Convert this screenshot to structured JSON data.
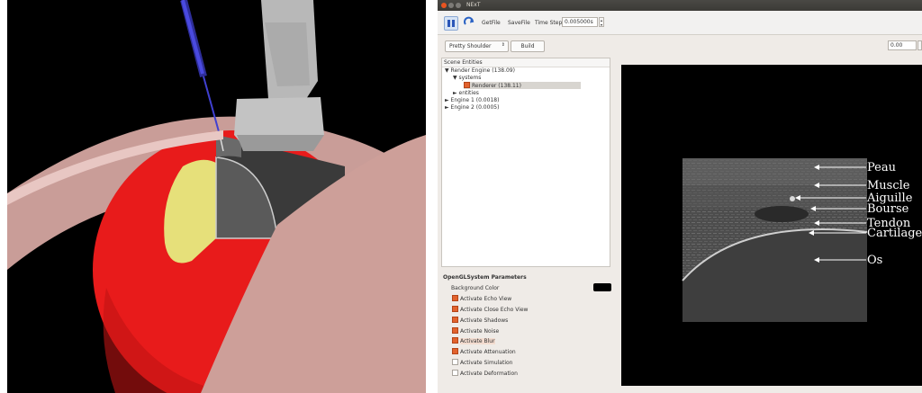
{
  "window": {
    "title": "NExT"
  },
  "toolbar": {
    "getfile_label": "GetFile",
    "savefile_label": "SaveFile",
    "timestep_label": "Time Step :",
    "timestep_value": "0.005000s"
  },
  "scene_selector": {
    "selected": "Pretty Shoulder",
    "build_label": "Build",
    "value": "0.00"
  },
  "scene_tree": {
    "header": "Scene Entities",
    "rows": [
      {
        "label": "Render Engine  (138.09)",
        "arrow": "▼"
      },
      {
        "label": "systems",
        "arrow": "▼"
      },
      {
        "label": "Renderer (138.11)",
        "checked": true
      },
      {
        "label": "entities",
        "arrow": "►"
      },
      {
        "label": "Engine 1 (0.0018)",
        "arrow": "►"
      },
      {
        "label": "Engine 2 (0.0005)",
        "arrow": "►"
      }
    ]
  },
  "params": {
    "title": "OpenGLSystem Parameters",
    "background_label": "Background Color",
    "background_color": "#000000",
    "options": [
      {
        "label": "Activate Echo View",
        "checked": true
      },
      {
        "label": "Activate Close Echo View",
        "checked": true
      },
      {
        "label": "Activate Shadows",
        "checked": true
      },
      {
        "label": "Activate Noise",
        "checked": true
      },
      {
        "label": "Activate Blur",
        "checked": true
      },
      {
        "label": "Activate Attenuation",
        "checked": true
      },
      {
        "label": "Activate Simulation",
        "checked": false
      },
      {
        "label": "Activate Deformation",
        "checked": false
      }
    ]
  },
  "ultrasound_labels": [
    "Peau",
    "Muscle",
    "Aiguille",
    "Bourse",
    "Tendon",
    "Cartilage",
    "Os"
  ],
  "colors": {
    "accent": "#e95420",
    "titlebar": "#3c3b37",
    "sphere": "#e81b1b",
    "skin": "#d9a8a3",
    "needle": "#3232c8"
  }
}
